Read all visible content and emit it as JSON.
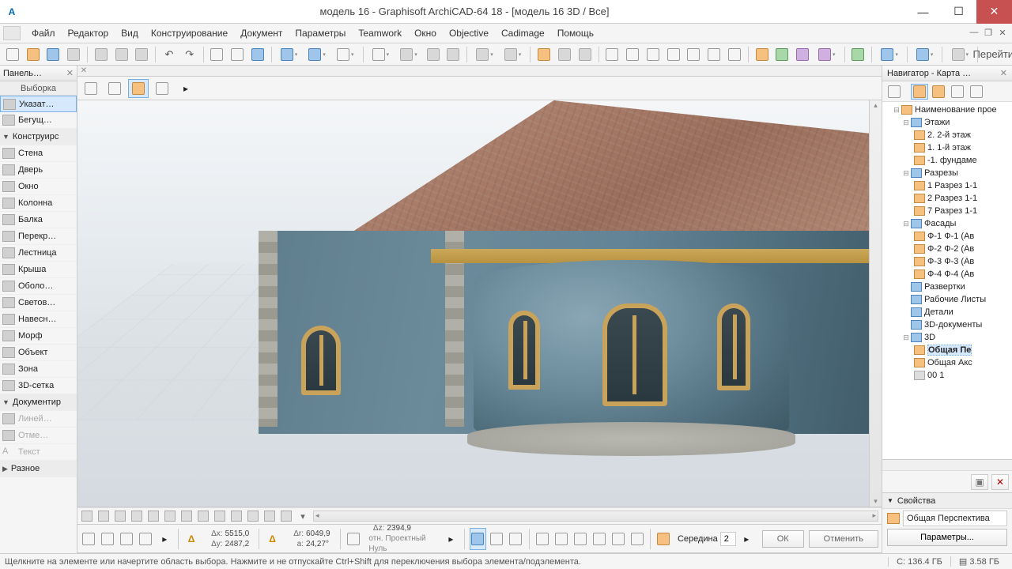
{
  "title": "модель 16 - Graphisoft ArchiCAD-64 18 - [модель 16 3D / Все]",
  "menu": [
    "Файл",
    "Редактор",
    "Вид",
    "Конструирование",
    "Документ",
    "Параметры",
    "Teamwork",
    "Окно",
    "Objective",
    "Cadimage",
    "Помощь"
  ],
  "toolbar": {
    "go_label": "Перейти"
  },
  "toolbox": {
    "panel_title": "Панель…",
    "sub_title": "Выборка",
    "arrow": "Указат…",
    "marquee": "Бегущ…",
    "cat_construct": "Конструирс",
    "wall": "Стена",
    "door": "Дверь",
    "window": "Окно",
    "column": "Колонна",
    "beam": "Балка",
    "slab": "Перекр…",
    "stair": "Лестница",
    "roof": "Крыша",
    "shell": "Оболо…",
    "skylight": "Светов…",
    "curtain": "Навесн…",
    "morph": "Морф",
    "object": "Объект",
    "zone": "Зона",
    "mesh": "3D-сетка",
    "cat_document": "Документир",
    "dim": "Линей…",
    "level": "Отме…",
    "text": "Текст",
    "cat_misc": "Разное"
  },
  "navigator": {
    "title": "Навигатор - Карта …",
    "root": "Наименование прое",
    "floors": "Этажи",
    "floor2": "2. 2-й этаж",
    "floor1": "1. 1-й этаж",
    "floor0": "-1. фундаме",
    "sections": "Разрезы",
    "section1": "1 Разрез 1-1",
    "section2": "2 Разрез 1-1",
    "section7": "7 Разрез 1-1",
    "elevations": "Фасады",
    "elev1": "Ф-1 Ф-1 (Ав",
    "elev2": "Ф-2 Ф-2 (Ав",
    "elev3": "Ф-3 Ф-3 (Ав",
    "elev4": "Ф-4 Ф-4 (Ав",
    "interior": "Развертки",
    "worksheets": "Рабочие Листы",
    "details": "Детали",
    "docs3d": "3D-документы",
    "node3d": "3D",
    "persp": "Общая Пе",
    "axo": "Общая Акс",
    "zero": "00 1",
    "props_title": "Свойства",
    "props_value": "Общая Перспектива",
    "params_btn": "Параметры..."
  },
  "coords": {
    "dx_label": "Δx:",
    "dx": "5515,0",
    "dy_label": "Δy:",
    "dy": "2487,2",
    "dr_label": "Δr:",
    "dr": "6049,9",
    "da_label": "a:",
    "da": "24,27°",
    "dz_label": "Δz:",
    "dz": "2394,9",
    "dz_sub": "отн. Проектный Нуль",
    "snap_label": "Середина",
    "snap_val": "2",
    "ok": "ОК",
    "cancel": "Отменить"
  },
  "status": {
    "hint": "Щелкните на элементе или начертите область выбора. Нажмите и не отпускайте Ctrl+Shift для переключения выбора элемента/подэлемента.",
    "mem1_label": "С:",
    "mem1": "136.4 ГБ",
    "mem2_label": "▤",
    "mem2": "3.58 ГБ"
  }
}
